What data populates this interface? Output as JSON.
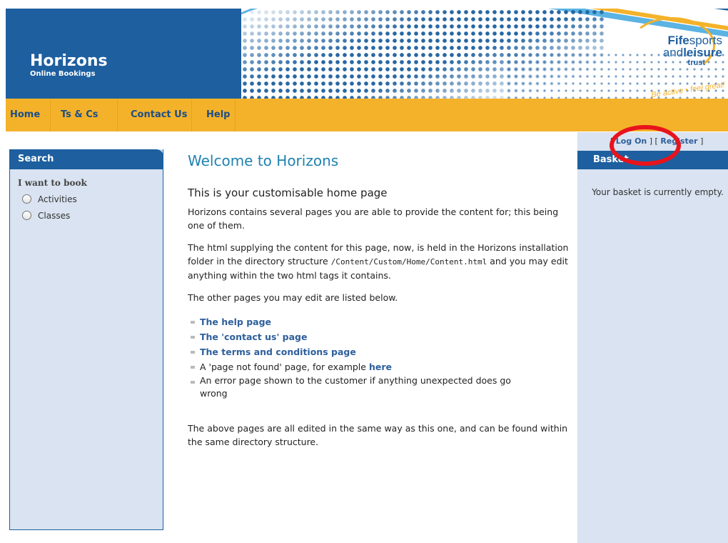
{
  "header": {
    "title": "Horizons",
    "subtitle": "Online Bookings",
    "logo": {
      "line1_bold": "Fife",
      "line1_rest": "sports",
      "line2_pre": "and",
      "line2_bold": "leisure",
      "line3": "trust",
      "tagline": "Be active • feel great!"
    },
    "colors": {
      "brand_blue": "#1d5f9f",
      "accent_yellow": "#f4b22a",
      "light_blue": "#5ab3e3"
    }
  },
  "nav": {
    "items": [
      {
        "label": "Home"
      },
      {
        "label": "Ts & Cs"
      },
      {
        "label": "Contact Us"
      },
      {
        "label": "Help"
      }
    ]
  },
  "search": {
    "heading": "Search",
    "group_label": "I want to book",
    "options": [
      {
        "label": "Activities",
        "selected": false
      },
      {
        "label": "Classes",
        "selected": false
      }
    ]
  },
  "main": {
    "title": "Welcome to Horizons",
    "subtitle": "This is your customisable home page",
    "para1": "Horizons contains several pages you are able to provide the content for; this being one of them.",
    "para2_a": "The html supplying the content for this page, now, is held in the Horizons installation folder in the directory structure ",
    "para2_code": "/Content/Custom/Home/Content.html",
    "para2_b": " and you may edit anything within the two html tags it contains.",
    "para3": "The other pages you may edit are listed below.",
    "list": {
      "item1": "The help page",
      "item2": "The 'contact us' page",
      "item3": "The terms and conditions page",
      "item4_text": "A 'page not found' page, for example ",
      "item4_link": "here",
      "item5_line1": "An error page shown to the customer if anything unexpected does go",
      "item5_line2": "wrong"
    },
    "para4": "The above pages are all edited in the same way as this one, and can be found within the same directory structure."
  },
  "auth": {
    "open": "[",
    "login": "Log On",
    "mid": "] [",
    "register": "Register",
    "close": "]"
  },
  "basket": {
    "heading": "Basket",
    "empty_message": "Your basket is currently empty."
  }
}
